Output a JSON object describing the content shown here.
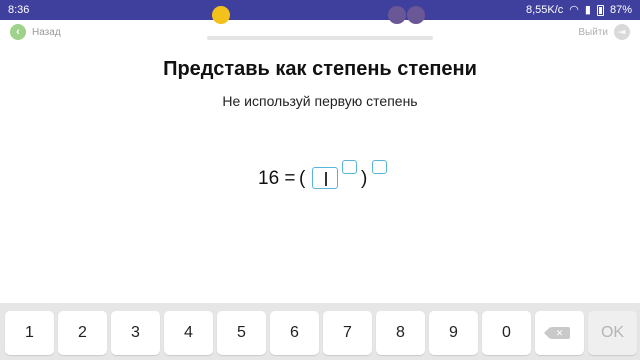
{
  "status_bar": {
    "time": "8:36",
    "network_speed": "8,55K/c",
    "battery": "87%",
    "icons": [
      "wifi-icon",
      "signal-icon",
      "battery-icon"
    ]
  },
  "nav": {
    "back_label": "Назад",
    "exit_label": "Выйти",
    "back_icon": "arrow-left-icon",
    "exit_icon": "exit-icon"
  },
  "progress": {
    "colors": {
      "done": "#f2c21b",
      "pending": "#6a5796",
      "track": "#e4e4e4"
    }
  },
  "task": {
    "title": "Представь как степень степени",
    "subtitle": "Не используй первую степень",
    "equation": {
      "left": "16 =",
      "open_paren": "(",
      "close_paren": ")"
    },
    "accent_color": "#58b4d8"
  },
  "keyboard": {
    "keys": [
      "1",
      "2",
      "3",
      "4",
      "5",
      "6",
      "7",
      "8",
      "9",
      "0"
    ],
    "backspace_icon": "backspace-icon",
    "ok_label": "OK"
  }
}
